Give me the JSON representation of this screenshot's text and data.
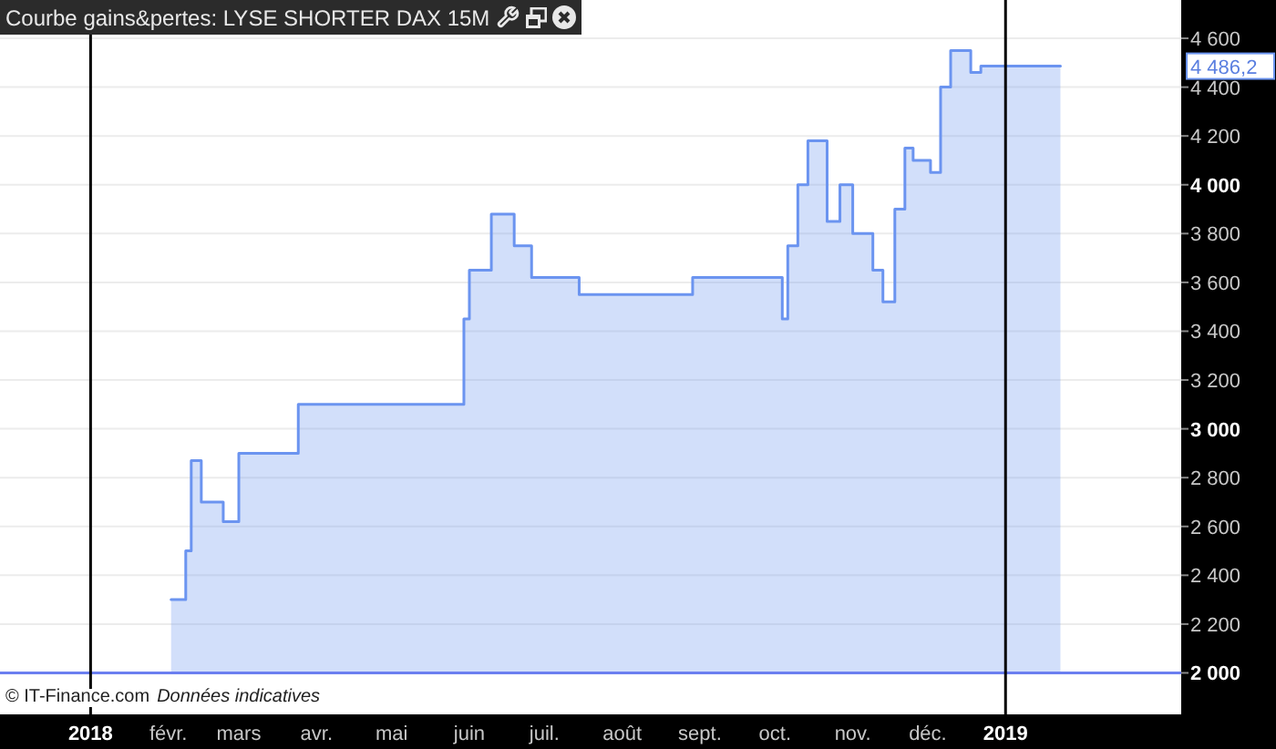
{
  "window": {
    "title": "Courbe gains&pertes: LYSE SHORTER DAX 15M"
  },
  "credit": {
    "source": "© IT-Finance.com",
    "note": "Données indicatives"
  },
  "chart_data": {
    "type": "area",
    "xlim": [
      2017.901,
      2019.192
    ],
    "ylim": [
      1830,
      4757
    ],
    "xticks": [
      2018,
      {
        "value": 2018.085,
        "label": "févr."
      },
      {
        "value": 2018.162,
        "label": "mars"
      },
      {
        "value": 2018.247,
        "label": "avr."
      },
      {
        "value": 2018.329,
        "label": "mai"
      },
      {
        "value": 2018.414,
        "label": "juin"
      },
      {
        "value": 2018.496,
        "label": "juil."
      },
      {
        "value": 2018.581,
        "label": "août"
      },
      {
        "value": 2018.666,
        "label": "sept."
      },
      {
        "value": 2018.748,
        "label": "oct."
      },
      {
        "value": 2018.833,
        "label": "nov."
      },
      {
        "value": 2018.915,
        "label": "déc."
      },
      2019
    ],
    "yticks": [
      {
        "value": 2000,
        "label": "2 000"
      },
      {
        "value": 2200,
        "label": "2 200"
      },
      {
        "value": 2400,
        "label": "2 400"
      },
      {
        "value": 2600,
        "label": "2 600"
      },
      {
        "value": 2800,
        "label": "2 800"
      },
      {
        "value": 3000,
        "label": "3 000"
      },
      {
        "value": 3200,
        "label": "3 200"
      },
      {
        "value": 3400,
        "label": "3 400"
      },
      {
        "value": 3600,
        "label": "3 600"
      },
      {
        "value": 3800,
        "label": "3 800"
      },
      {
        "value": 4000,
        "label": "4 000"
      },
      {
        "value": 4200,
        "label": "4 200"
      },
      {
        "value": 4400,
        "label": "4 400"
      },
      {
        "value": 4600,
        "label": "4 600"
      }
    ],
    "x": [
      2018.088,
      2018.104,
      2018.104,
      2018.11,
      2018.11,
      2018.121,
      2018.121,
      2018.145,
      2018.145,
      2018.162,
      2018.162,
      2018.227,
      2018.227,
      2018.408,
      2018.408,
      2018.414,
      2018.414,
      2018.438,
      2018.438,
      2018.463,
      2018.463,
      2018.482,
      2018.482,
      2018.534,
      2018.534,
      2018.658,
      2018.658,
      2018.756,
      2018.756,
      2018.762,
      2018.762,
      2018.773,
      2018.773,
      2018.784,
      2018.784,
      2018.805,
      2018.805,
      2018.819,
      2018.819,
      2018.833,
      2018.833,
      2018.855,
      2018.855,
      2018.866,
      2018.866,
      2018.879,
      2018.879,
      2018.89,
      2018.89,
      2018.899,
      2018.899,
      2018.918,
      2018.918,
      2018.929,
      2018.929,
      2018.94,
      2018.94,
      2018.962,
      2018.962,
      2018.973,
      2018.973,
      2019.06
    ],
    "series": [
      {
        "color": "#6b94f0",
        "values": [
          2300,
          2300,
          2500,
          2500,
          2870,
          2870,
          2700,
          2700,
          2620,
          2620,
          2900,
          2900,
          3100,
          3100,
          3450,
          3450,
          3650,
          3650,
          3880,
          3880,
          3750,
          3750,
          3620,
          3620,
          3550,
          3550,
          3620,
          3620,
          3450,
          3450,
          3750,
          3750,
          4000,
          4000,
          4180,
          4180,
          3850,
          3850,
          4000,
          4000,
          3800,
          3800,
          3650,
          3650,
          3520,
          3520,
          3900,
          3900,
          4150,
          4150,
          4100,
          4100,
          4050,
          4050,
          4400,
          4400,
          4550,
          4550,
          4460,
          4460,
          4486,
          4486
        ]
      }
    ],
    "grid": true,
    "ref_lines": [
      {
        "axis": "y",
        "value": 2000,
        "color": "#6b7ff0"
      }
    ]
  },
  "current_value": {
    "label": "4 486,2"
  }
}
